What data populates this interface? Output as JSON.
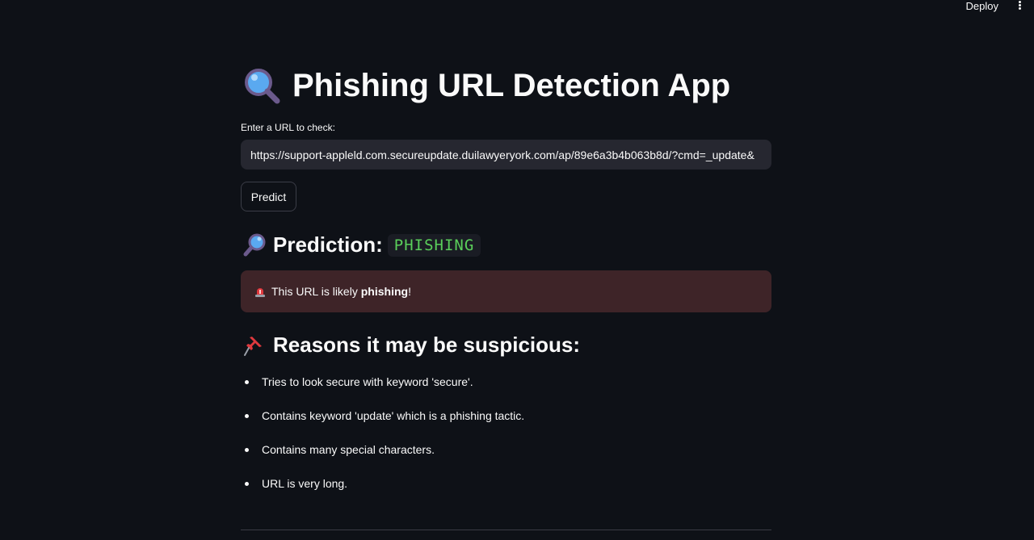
{
  "header": {
    "deploy_label": "Deploy"
  },
  "page": {
    "title": "Phishing URL Detection App",
    "input_label": "Enter a URL to check:",
    "url_value": "https://support-appleld.com.secureupdate.duilawyeryork.com/ap/89e6a3b4b063b8d/?cmd=_update&",
    "predict_label": "Predict"
  },
  "prediction": {
    "label": "Prediction:",
    "value": "PHISHING",
    "value_color": "#5ace5a"
  },
  "alert": {
    "text_before": "This URL is likely ",
    "text_bold": "phishing",
    "text_after": "!",
    "background": "#3e2428"
  },
  "reasons": {
    "heading": "Reasons it may be suspicious:",
    "items": [
      "Tries to look secure with keyword 'secure'.",
      "Contains keyword 'update' which is a phishing tactic.",
      "Contains many special characters.",
      "URL is very long."
    ]
  },
  "icons": {
    "title_icon": "magnifier-left-icon",
    "prediction_icon": "magnifier-right-icon",
    "alert_icon": "siren-icon",
    "reasons_icon": "pushpin-icon",
    "menu_icon": "more-vertical-icon"
  }
}
